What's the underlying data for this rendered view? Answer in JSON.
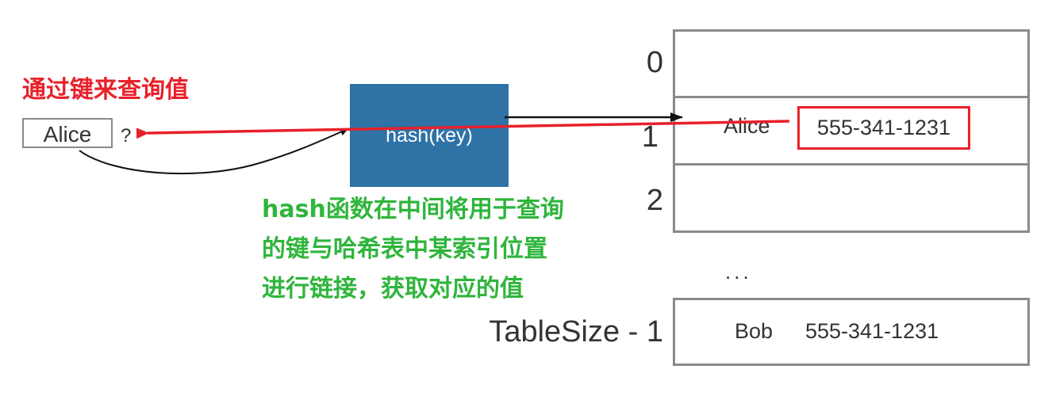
{
  "annotations": {
    "red_title": "通过键来查询值",
    "green_lines": [
      "hash函数在中间将用于查询",
      "的键与哈希表中某索引位置",
      "进行链接，获取对应的值"
    ]
  },
  "key": {
    "label": "Alice",
    "question": "?"
  },
  "hash_box": {
    "label": "hash(key)"
  },
  "table": {
    "indices": [
      "0",
      "1",
      "2",
      "TableSize - 1"
    ],
    "row1": {
      "name": "Alice",
      "phone": "555-341-1231"
    },
    "last_row": {
      "name": "Bob",
      "phone": "555-341-1231"
    },
    "ellipsis": "..."
  },
  "colors": {
    "red": "#e8202a",
    "green": "#2fb53c",
    "blue_box": "#2e72a6",
    "border_gray": "#8a8a8a"
  }
}
